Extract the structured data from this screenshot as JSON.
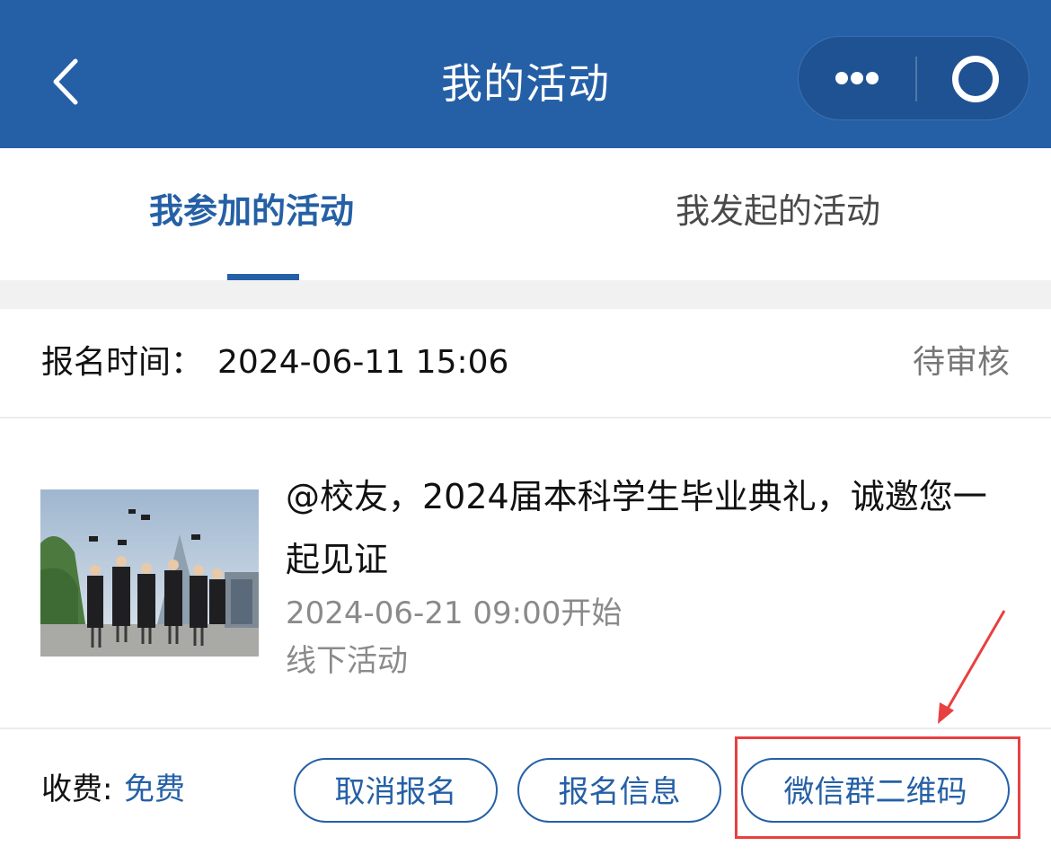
{
  "header": {
    "title": "我的活动"
  },
  "tabs": [
    {
      "label": "我参加的活动",
      "active": true
    },
    {
      "label": "我发起的活动",
      "active": false
    }
  ],
  "activity": {
    "signup_label": "报名时间：",
    "signup_time": "2024-06-11 15:06",
    "status": "待审核",
    "title": "@校友，2024届本科学生毕业典礼，诚邀您一起见证",
    "start_time": "2024-06-21 09:00开始",
    "type": "线下活动",
    "fee_label": "收费: ",
    "fee_value": "免费"
  },
  "buttons": {
    "cancel": "取消报名",
    "info": "报名信息",
    "qr": "微信群二维码"
  },
  "colors": {
    "primary": "#2560a6",
    "annotation": "#e84040"
  }
}
